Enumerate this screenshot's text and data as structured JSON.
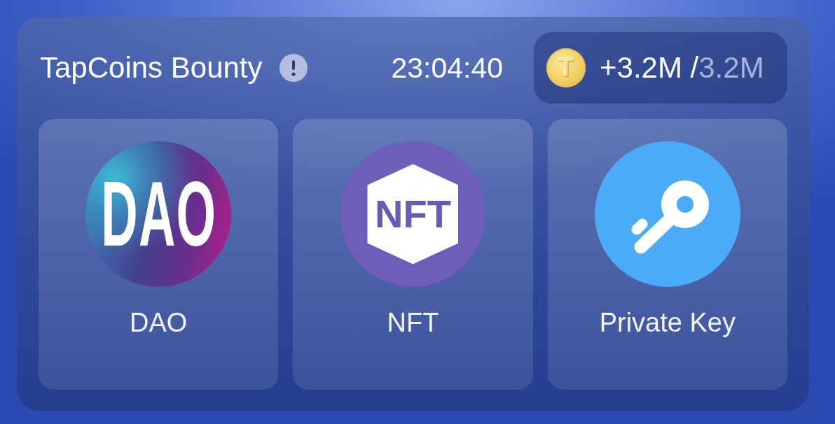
{
  "header": {
    "title": "TapCoins Bounty",
    "countdown": "23:04:40",
    "reward": {
      "coin_letter": "T",
      "amount": "+3.2M /",
      "total": "3.2M"
    }
  },
  "cards": [
    {
      "kind": "dao",
      "logo_text": "DAO",
      "label": "DAO"
    },
    {
      "kind": "nft",
      "logo_text": "NFT",
      "label": "NFT"
    },
    {
      "kind": "key",
      "label": "Private Key"
    }
  ]
}
